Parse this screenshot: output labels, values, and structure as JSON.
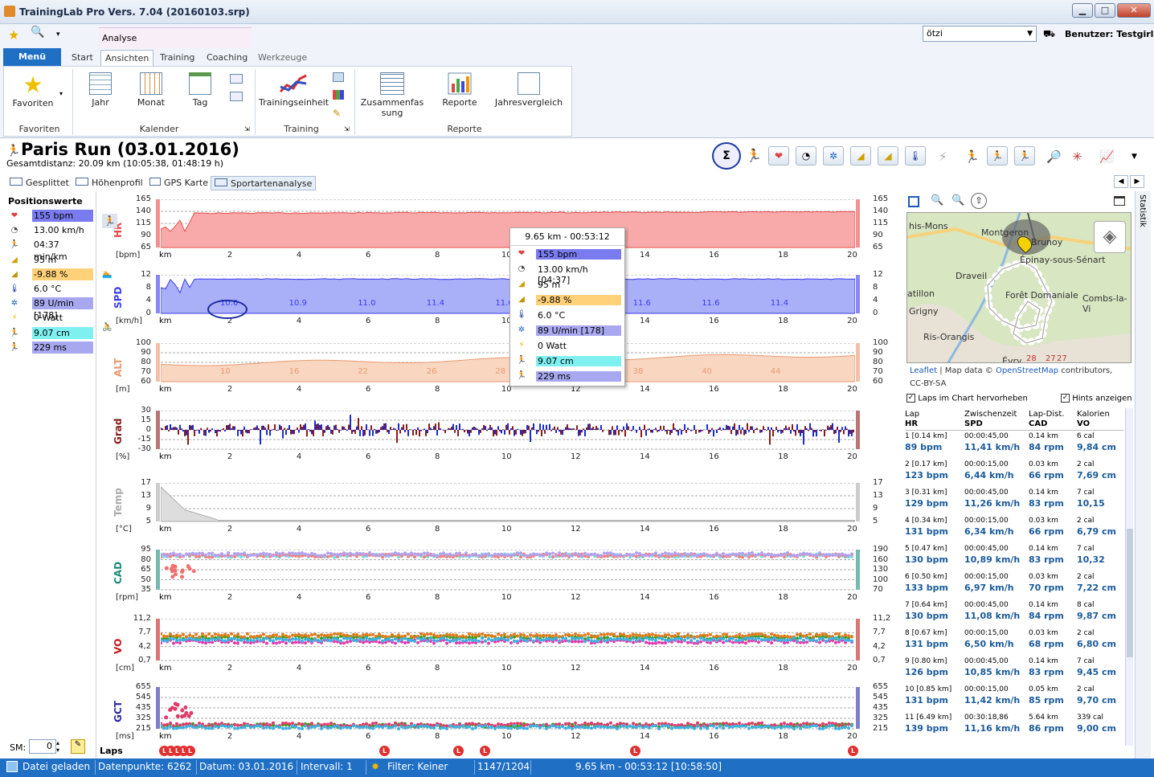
{
  "window": {
    "title": "TrainingLab Pro Vers. 7.04 (20160103.srp)"
  },
  "ribbon": {
    "context_tab": "Analyse",
    "menu_label": "Menü",
    "tabs": [
      "Start",
      "Ansichten",
      "Training",
      "Coaching",
      "Werkzeuge"
    ],
    "user_combo": "ötzi",
    "user_label": "Benutzer: Testgirl",
    "groups": [
      {
        "label": "Favoriten",
        "buttons": [
          "Favoriten"
        ]
      },
      {
        "label": "Kalender",
        "buttons": [
          "Jahr",
          "Monat",
          "Tag"
        ]
      },
      {
        "label": "Training",
        "buttons": [
          "Trainingseinheit"
        ]
      },
      {
        "label": "Reporte",
        "buttons": [
          "Zusammenfassung",
          "Reporte",
          "Jahresvergleich"
        ]
      }
    ]
  },
  "header": {
    "title": "Paris Run (03.01.2016)",
    "subtitle": "Gesamtdistanz: 20.09 km (10:05:38, 01:48:19 h)"
  },
  "subtabs": [
    "Gesplittet",
    "Höhenprofil",
    "GPS Karte",
    "Sportartenanalyse"
  ],
  "position_values": {
    "title": "Positionswerte",
    "items": [
      {
        "icon": "heart-icon",
        "text": "155 bpm",
        "color": "#7b7bf0"
      },
      {
        "icon": "speed-icon",
        "text": "13.00 km/h",
        "color": ""
      },
      {
        "icon": "runner-icon",
        "text": "04:37 min/km",
        "color": ""
      },
      {
        "icon": "altitude-icon",
        "text": "95 m",
        "color": ""
      },
      {
        "icon": "grade-icon",
        "text": "-9.88 %",
        "color": "#ffd27a"
      },
      {
        "icon": "thermometer-icon",
        "text": "6.0 °C",
        "color": ""
      },
      {
        "icon": "cadence-icon",
        "text": "89 U/min [178]",
        "color": "#a8a8f0"
      },
      {
        "icon": "power-icon",
        "text": "0 Watt",
        "color": ""
      },
      {
        "icon": "vertical-osc-icon",
        "text": "9.07 cm",
        "color": "#7ff0f0"
      },
      {
        "icon": "gct-icon",
        "text": "229 ms",
        "color": "#a8a8f0"
      }
    ],
    "sm_label": "SM:",
    "sm_value": "0"
  },
  "tooltip": {
    "header": "9.65 km - 00:53:12",
    "items": [
      {
        "icon": "heart-icon",
        "text": "155 bpm",
        "color": "#7b7bf0"
      },
      {
        "icon": "speed-icon",
        "text": "13.00 km/h [04:37]",
        "color": ""
      },
      {
        "icon": "altitude-icon",
        "text": "95 m",
        "color": ""
      },
      {
        "icon": "grade-icon",
        "text": "-9.88 %",
        "color": "#ffd27a"
      },
      {
        "icon": "thermometer-icon",
        "text": "6.0 °C",
        "color": ""
      },
      {
        "icon": "cadence-icon",
        "text": "89 U/min [178]",
        "color": "#a8a8f0"
      },
      {
        "icon": "power-icon",
        "text": "0 Watt",
        "color": ""
      },
      {
        "icon": "vertical-osc-icon",
        "text": "9.07 cm",
        "color": "#7ff0f0"
      },
      {
        "icon": "gct-icon",
        "text": "229 ms",
        "color": "#a8a8f0"
      }
    ]
  },
  "chart_data": [
    {
      "type": "area",
      "id": "hr",
      "label": "HR",
      "unit": "[bpm]",
      "yticks": [
        "165",
        "140",
        "115",
        "90",
        "65"
      ],
      "color": "#e84a4a",
      "fill": "#f8aaaa"
    },
    {
      "type": "area",
      "id": "spd",
      "label": "SPD",
      "unit": "[km/h]",
      "yticks": [
        "12",
        "8",
        "4",
        "0"
      ],
      "color": "#3a3af0",
      "fill": "#aab0f8",
      "annotations": [
        "10.6",
        "10.9",
        "11.0",
        "11.4",
        "11.6",
        "11.7",
        "11.6",
        "11.6",
        "11.4"
      ]
    },
    {
      "type": "area",
      "id": "alt",
      "label": "ALT",
      "unit": "[m]",
      "yticks": [
        "100",
        "90",
        "80",
        "70",
        "60"
      ],
      "color": "#e89a70",
      "fill": "#f8d6c0",
      "annotations": [
        "10",
        "16",
        "22",
        "26",
        "28",
        "38",
        "38",
        "40",
        "44"
      ]
    },
    {
      "type": "bar",
      "id": "grad",
      "label": "Grad",
      "unit": "[%]",
      "yticks": [
        "30",
        "15",
        "0",
        "-15",
        "-30"
      ],
      "color": "#8a1a1a"
    },
    {
      "type": "area",
      "id": "temp",
      "label": "Temp",
      "unit": "[°C]",
      "yticks": [
        "17",
        "13",
        "9",
        "5"
      ],
      "color": "#aaaaaa"
    },
    {
      "type": "scatter",
      "id": "cad",
      "label": "CAD",
      "unit": "[rpm]",
      "yticks": [
        "95",
        "80",
        "65",
        "50",
        "35"
      ],
      "yticks_right": [
        "190",
        "160",
        "130",
        "100",
        "70"
      ],
      "color": "#1a8a7a"
    },
    {
      "type": "scatter",
      "id": "vo",
      "label": "VO",
      "unit": "[cm]",
      "yticks": [
        "11,2",
        "7,7",
        "4,2",
        "0,7"
      ],
      "yticks_right": [
        "11,2",
        "7,7",
        "4,2",
        "0,7"
      ],
      "color": "#c01a1a"
    },
    {
      "type": "scatter",
      "id": "gct",
      "label": "GCT",
      "unit": "[ms]",
      "yticks": [
        "655",
        "545",
        "435",
        "325",
        "215"
      ],
      "yticks_right": [
        "655",
        "545",
        "435",
        "325",
        "215"
      ],
      "color": "#2a2aa0"
    }
  ],
  "x_axis": {
    "label": "km",
    "ticks": [
      "2",
      "4",
      "6",
      "8",
      "10",
      "12",
      "14",
      "16",
      "18",
      "20"
    ]
  },
  "laps_label": "Laps",
  "right_panel": {
    "map_labels": [
      "his-Mons",
      "Montgeron",
      "Brunoy",
      "Draveil",
      "Épinay-sous-Sénart",
      "atillon",
      "Combs-la-Vi",
      "Grigny",
      "Forêt Domaniale",
      "Ris-Orangis",
      "Évry",
      "28",
      "27",
      "27"
    ],
    "attribution_link1": "Leaflet",
    "attribution_mid": " | Map data © ",
    "attribution_link2": "OpenStreetMap",
    "attribution_rest": " contributors, CC-BY-SA",
    "chk_laps": "Laps im Chart hervorheben",
    "chk_hints": "Hints anzeigen",
    "lap_headers": {
      "c1a": "Lap",
      "c1b": "HR",
      "c2a": "Zwischenzeit",
      "c2b": "SPD",
      "c3a": "Lap-Dist.",
      "c3b": "CAD",
      "c4a": "Kalorien",
      "c4b": "VO"
    },
    "laps": [
      {
        "a": "1 [0.14 km]",
        "b": "00:00:45,00",
        "c": "0.14 km",
        "d": "6 cal",
        "hr": "89 bpm",
        "spd": "11,41 km/h",
        "cad": "84 rpm",
        "vo": "9,84 cm"
      },
      {
        "a": "2 [0.17 km]",
        "b": "00:00:15,00",
        "c": "0.03 km",
        "d": "2 cal",
        "hr": "123 bpm",
        "spd": "6,44 km/h",
        "cad": "66 rpm",
        "vo": "7,69 cm"
      },
      {
        "a": "3 [0.31 km]",
        "b": "00:00:45,00",
        "c": "0.14 km",
        "d": "7 cal",
        "hr": "129 bpm",
        "spd": "11,26 km/h",
        "cad": "83 rpm",
        "vo": "10,15"
      },
      {
        "a": "4 [0.34 km]",
        "b": "00:00:15,00",
        "c": "0.03 km",
        "d": "2 cal",
        "hr": "131 bpm",
        "spd": "6,34 km/h",
        "cad": "66 rpm",
        "vo": "6,79 cm"
      },
      {
        "a": "5 [0.47 km]",
        "b": "00:00:45,00",
        "c": "0.14 km",
        "d": "7 cal",
        "hr": "130 bpm",
        "spd": "10,89 km/h",
        "cad": "83 rpm",
        "vo": "10,32"
      },
      {
        "a": "6 [0.50 km]",
        "b": "00:00:15,00",
        "c": "0.03 km",
        "d": "2 cal",
        "hr": "133 bpm",
        "spd": "6,97 km/h",
        "cad": "70 rpm",
        "vo": "7,22 cm"
      },
      {
        "a": "7 [0.64 km]",
        "b": "00:00:45,00",
        "c": "0.14 km",
        "d": "8 cal",
        "hr": "130 bpm",
        "spd": "11,08 km/h",
        "cad": "84 rpm",
        "vo": "9,87 cm"
      },
      {
        "a": "8 [0.67 km]",
        "b": "00:00:15,00",
        "c": "0.03 km",
        "d": "2 cal",
        "hr": "131 bpm",
        "spd": "6,50 km/h",
        "cad": "68 rpm",
        "vo": "6,80 cm"
      },
      {
        "a": "9 [0.80 km]",
        "b": "00:00:45,00",
        "c": "0.14 km",
        "d": "7 cal",
        "hr": "126 bpm",
        "spd": "10,85 km/h",
        "cad": "83 rpm",
        "vo": "9,45 cm"
      },
      {
        "a": "10 [0.85 km]",
        "b": "00:00:15,00",
        "c": "0.05 km",
        "d": "2 cal",
        "hr": "131 bpm",
        "spd": "11,42 km/h",
        "cad": "85 rpm",
        "vo": "9,70 cm"
      },
      {
        "a": "11 [6.49 km]",
        "b": "00:30:18,86",
        "c": "5.64 km",
        "d": "339 cal",
        "hr": "139 bpm",
        "spd": "11,16 km/h",
        "cad": "86 rpm",
        "vo": "9,00 cm"
      }
    ]
  },
  "vertical_tab": "Statistik",
  "status": {
    "s1": "Datei geladen",
    "s2": "Datenpunkte: 6262",
    "s3": "Datum: 03.01.2016",
    "s4": "Intervall: 1",
    "s5": "Filter: Keiner",
    "s6": "1147/1204",
    "s7": "9.65 km - 00:53:12 [10:58:50]"
  }
}
